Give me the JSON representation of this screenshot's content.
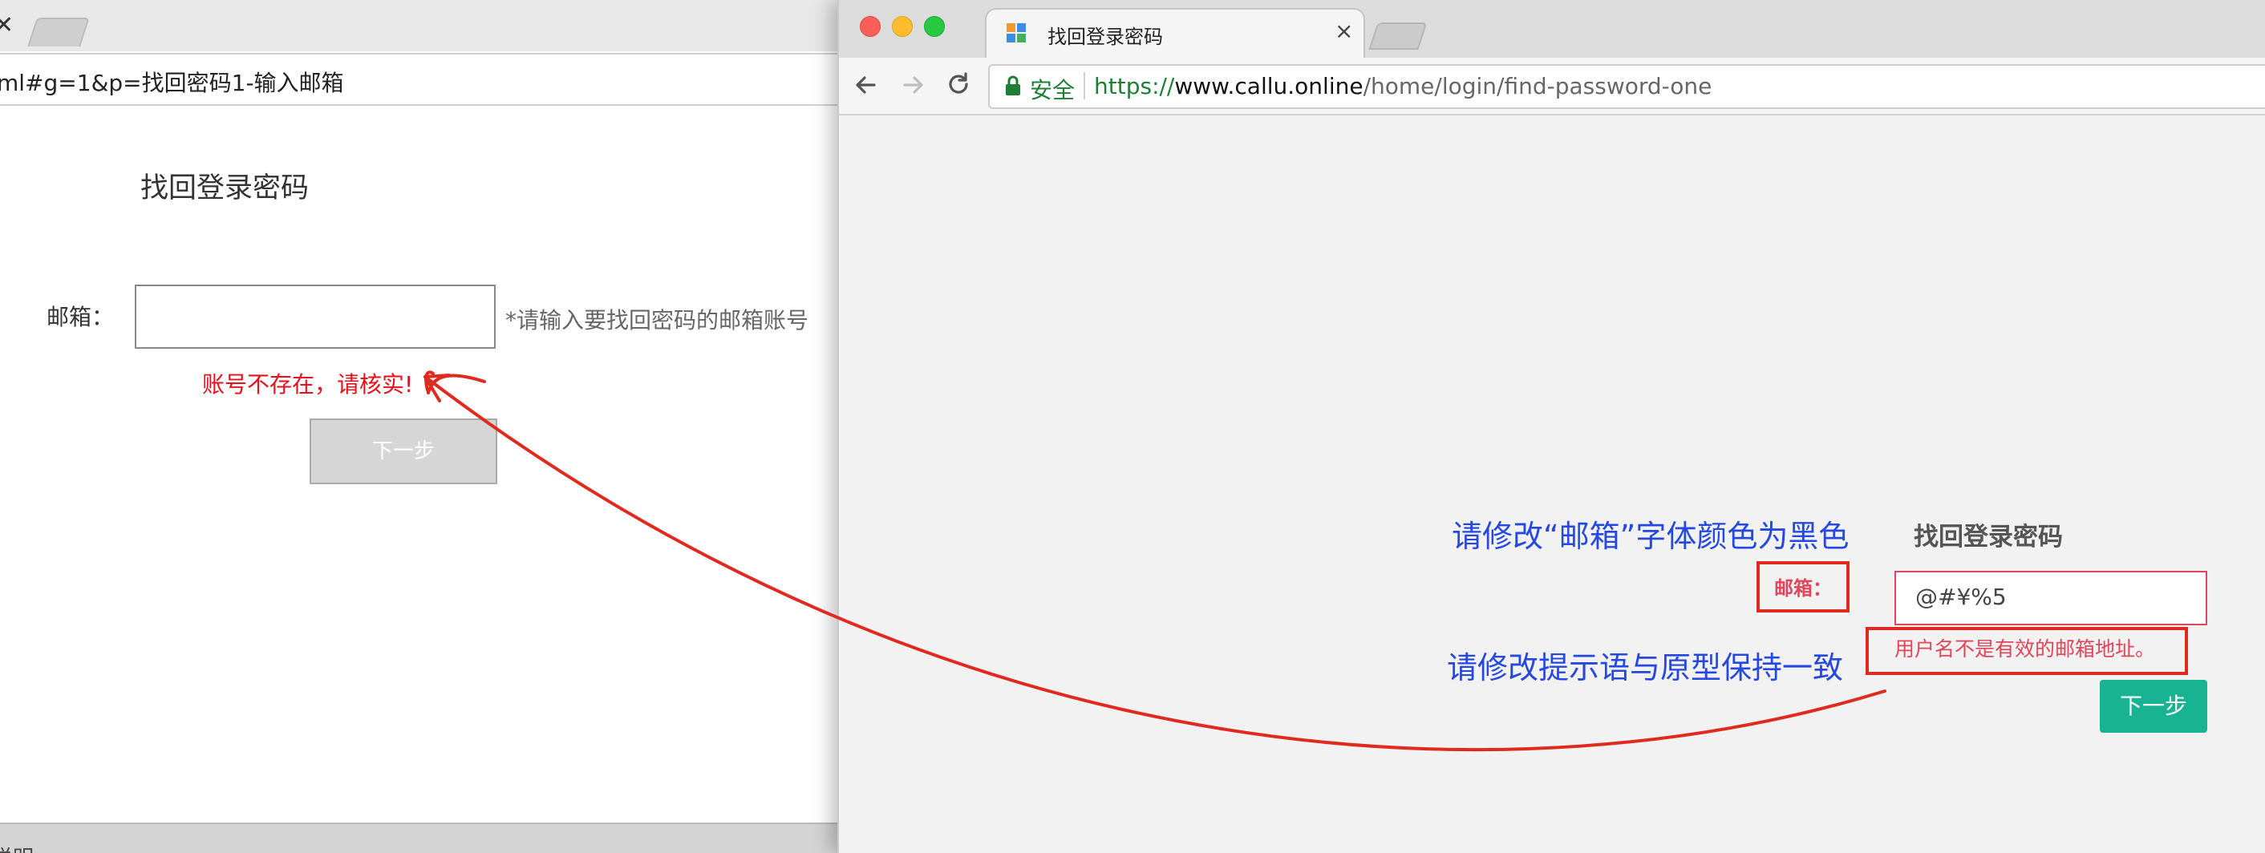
{
  "prototype": {
    "url": "ml#g=1&p=找回密码1-输入邮箱",
    "title": "找回登录密码",
    "email_label": "邮箱：",
    "email_hint": "*请输入要找回密码的邮箱账号",
    "error": "账号不存在，请核实!",
    "next_button": "下一步",
    "footer_text": "说明"
  },
  "browser": {
    "tab_title": "找回登录密码",
    "tab_close": "×",
    "secure_label": "安全",
    "url_scheme": "https://",
    "url_host": "www.callu.online",
    "url_path": "/home/login/find-password-one"
  },
  "page": {
    "title": "找回登录密码",
    "email_label": "邮箱：",
    "email_value": "@#¥%5",
    "error": "用户名不是有效的邮箱地址。",
    "next_button": "下一步"
  },
  "annotations": {
    "label_color_note": "请修改“邮箱”字体颜色为黑色",
    "error_text_note": "请修改提示语与原型保持一致"
  },
  "colors": {
    "annotation_text": "#2548e0",
    "annotation_marker": "#e12a1f",
    "prototype_error": "#e8101a",
    "page_error": "#e0455a",
    "next_button": "#17b393",
    "secure": "#1e7e34"
  }
}
